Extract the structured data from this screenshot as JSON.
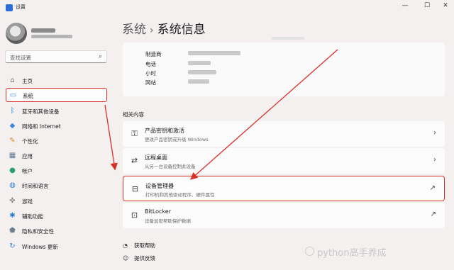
{
  "window": {
    "title": "设置",
    "controls": [
      "—",
      "☐",
      "✕"
    ]
  },
  "search": {
    "placeholder": "查找设置",
    "icon": "search-icon"
  },
  "nav": {
    "items": [
      {
        "label": "主页",
        "icon": "home-icon",
        "color": "#6f6f6f"
      },
      {
        "label": "系统",
        "icon": "system-icon",
        "color": "#3b87d9",
        "active": true
      },
      {
        "label": "蓝牙和其他设备",
        "icon": "bluetooth-icon",
        "color": "#2a7fd4"
      },
      {
        "label": "网络和 Internet",
        "icon": "network-icon",
        "color": "#3b87d9"
      },
      {
        "label": "个性化",
        "icon": "brush-icon",
        "color": "#d98b2b"
      },
      {
        "label": "应用",
        "icon": "apps-icon",
        "color": "#5a6f8f"
      },
      {
        "label": "帐户",
        "icon": "account-icon",
        "color": "#2a9d6f"
      },
      {
        "label": "时间和语言",
        "icon": "globe-icon",
        "color": "#2a7fd4"
      },
      {
        "label": "游戏",
        "icon": "gamepad-icon",
        "color": "#7a7a7a"
      },
      {
        "label": "辅助功能",
        "icon": "accessibility-icon",
        "color": "#2a7fd4"
      },
      {
        "label": "隐私和安全性",
        "icon": "shield-icon",
        "color": "#6f7f8f"
      },
      {
        "label": "Windows 更新",
        "icon": "update-icon",
        "color": "#2a7fd4"
      }
    ]
  },
  "breadcrumb": {
    "parent": "系统",
    "separator": "›",
    "current": "系统信息"
  },
  "system_info": {
    "rows": [
      {
        "key": "制造商"
      },
      {
        "key": "电话"
      },
      {
        "key": "小时"
      },
      {
        "key": "网站"
      }
    ]
  },
  "related": {
    "heading": "相关内容",
    "cards": [
      {
        "title": "产品密钥和激活",
        "subtitle": "更改产品密钥或升级 Windows",
        "icon": "key-icon",
        "action": "chevron-right-icon"
      },
      {
        "title": "远程桌面",
        "subtitle": "从另一台设备控制此设备",
        "icon": "remote-desktop-icon",
        "action": "chevron-right-icon"
      },
      {
        "title": "设备管理器",
        "subtitle": "打印机和其他驱动程序、硬件属性",
        "icon": "device-manager-icon",
        "action": "external-link-icon",
        "highlighted": true
      },
      {
        "title": "BitLocker",
        "subtitle": "设备加密帮助保护数据",
        "icon": "bitlocker-icon",
        "action": "external-link-icon"
      }
    ]
  },
  "help": {
    "get_help": "获取帮助",
    "feedback": "提供反馈"
  },
  "watermark": "python高手养成",
  "annotation_color": "#d93025"
}
